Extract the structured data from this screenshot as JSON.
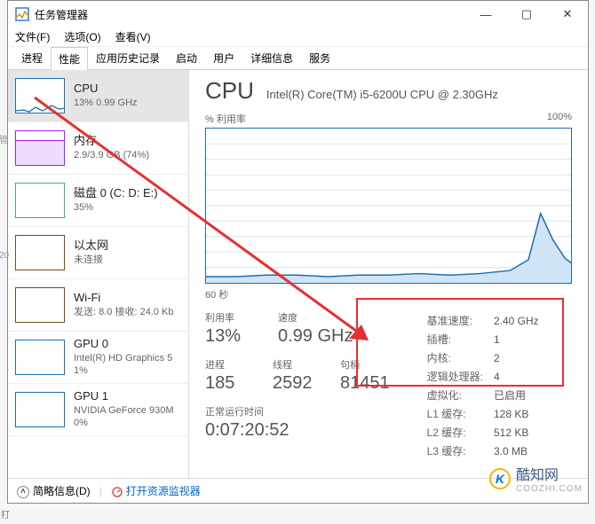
{
  "window": {
    "title": "任务管理器",
    "menus": [
      "文件(F)",
      "选项(O)",
      "查看(V)"
    ],
    "tabs": [
      "进程",
      "性能",
      "应用历史记录",
      "启动",
      "用户",
      "详细信息",
      "服务"
    ],
    "active_tab": "性能"
  },
  "sidebar": {
    "items": [
      {
        "name": "CPU",
        "sub": "13% 0.99 GHz",
        "kind": "cpu",
        "selected": true
      },
      {
        "name": "内存",
        "sub": "2.9/3.9 GB (74%)",
        "kind": "mem"
      },
      {
        "name": "磁盘 0 (C: D: E:)",
        "sub": "35%",
        "kind": "disk"
      },
      {
        "name": "以太网",
        "sub": "未连接",
        "kind": "net"
      },
      {
        "name": "Wi-Fi",
        "sub": "发送: 8.0 接收: 24.0 Kb",
        "kind": "wifi"
      },
      {
        "name": "GPU 0",
        "sub": "Intel(R) HD Graphics 5\n1%",
        "kind": "gpu"
      },
      {
        "name": "GPU 1",
        "sub": "NVIDIA GeForce 930M\n0%",
        "kind": "gpu"
      }
    ]
  },
  "main": {
    "title": "CPU",
    "subtitle": "Intel(R) Core(TM) i5-6200U CPU @ 2.30GHz",
    "graph_label": "% 利用率",
    "graph_max": "100%",
    "graph_xaxis": "60 秒",
    "stats1": {
      "labels": [
        "利用率",
        "速度"
      ],
      "values": [
        "13%",
        "0.99 GHz"
      ]
    },
    "stats2": {
      "labels": [
        "进程",
        "线程",
        "句柄"
      ],
      "values": [
        "185",
        "2592",
        "81451"
      ]
    },
    "uptime_label": "正常运行时间",
    "uptime": "0:07:20:52",
    "details": [
      [
        "基准速度:",
        "2.40 GHz"
      ],
      [
        "插槽:",
        "1"
      ],
      [
        "内核:",
        "2"
      ],
      [
        "逻辑处理器:",
        "4"
      ],
      [
        "虚拟化:",
        "已启用"
      ],
      [
        "L1 缓存:",
        "128 KB"
      ],
      [
        "L2 缓存:",
        "512 KB"
      ],
      [
        "L3 缓存:",
        "3.0 MB"
      ]
    ]
  },
  "statusbar": {
    "less": "简略信息(D)",
    "link": "打开资源监视器"
  },
  "watermark": {
    "brand": "酷知网",
    "domain": "COOZHI.COM",
    "logo": "K"
  },
  "chart_data": {
    "type": "line",
    "title": "% 利用率",
    "xlabel": "60 秒",
    "ylabel": "%",
    "ylim": [
      0,
      100
    ],
    "x_seconds_ago": [
      60,
      55,
      50,
      45,
      40,
      35,
      30,
      25,
      20,
      15,
      10,
      7,
      5,
      3,
      1,
      0
    ],
    "utilization_pct": [
      4,
      4,
      5,
      5,
      4,
      5,
      5,
      6,
      5,
      6,
      8,
      15,
      45,
      28,
      16,
      13
    ]
  }
}
